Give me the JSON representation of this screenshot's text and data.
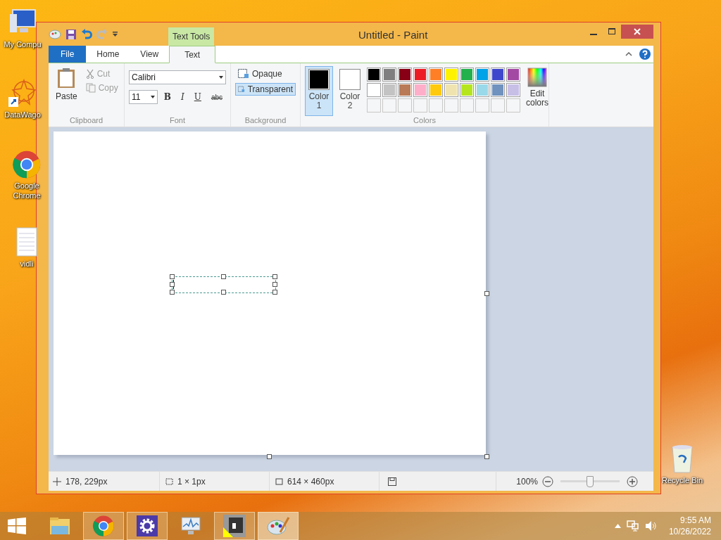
{
  "desktop_icons": [
    {
      "label": "My Compu",
      "kind": "computer"
    },
    {
      "label": "DataWago",
      "kind": "star"
    },
    {
      "label": "Google Chrome",
      "kind": "chrome"
    },
    {
      "label": "vidli",
      "kind": "document"
    }
  ],
  "recycle_bin": {
    "label": "Recycle Bin"
  },
  "window": {
    "title": "Untitled - Paint",
    "context_label": "Text Tools",
    "quick_access": [
      {
        "kind": "app"
      },
      {
        "kind": "save",
        "disabled": false
      },
      {
        "kind": "undo",
        "disabled": false
      },
      {
        "kind": "redo",
        "disabled": true
      },
      {
        "kind": "customize",
        "disabled": false
      }
    ],
    "tabs": [
      {
        "label": "File",
        "kind": "file",
        "selected": false
      },
      {
        "label": "Home",
        "kind": "tab",
        "selected": false
      },
      {
        "label": "View",
        "kind": "tab",
        "selected": false
      },
      {
        "label": "Text",
        "kind": "tab",
        "selected": true
      }
    ],
    "clipboard": {
      "label": "Clipboard",
      "paste": "Paste",
      "cut": {
        "label": "Cut",
        "disabled": true
      },
      "copy": {
        "label": "Copy",
        "disabled": true
      }
    },
    "font": {
      "label": "Font",
      "family": "Calibri",
      "size": "11",
      "styles": [
        {
          "label": "B",
          "kind": "bold"
        },
        {
          "label": "I",
          "kind": "italic"
        },
        {
          "label": "U",
          "kind": "underline"
        },
        {
          "label": "abc",
          "kind": "strike"
        }
      ]
    },
    "background": {
      "label": "Background",
      "options": [
        {
          "label": "Opaque",
          "selected": false
        },
        {
          "label": "Transparent",
          "selected": true
        }
      ]
    },
    "colors": {
      "label": "Colors",
      "slots": [
        {
          "label": "Color",
          "number": "1",
          "color": "#000000",
          "selected": true
        },
        {
          "label": "Color",
          "number": "2",
          "color": "#ffffff",
          "selected": false
        }
      ],
      "palette": [
        {
          "color": "#000000"
        },
        {
          "color": "#7f7f7f"
        },
        {
          "color": "#880015"
        },
        {
          "color": "#ed1c24"
        },
        {
          "color": "#ff7f27"
        },
        {
          "color": "#fff200"
        },
        {
          "color": "#22b14c"
        },
        {
          "color": "#00a2e8"
        },
        {
          "color": "#3f48cc"
        },
        {
          "color": "#a349a4"
        },
        {
          "color": "#ffffff"
        },
        {
          "color": "#c3c3c3"
        },
        {
          "color": "#b97a57"
        },
        {
          "color": "#ffaec9"
        },
        {
          "color": "#ffc90e"
        },
        {
          "color": "#efe4b0"
        },
        {
          "color": "#b5e61d"
        },
        {
          "color": "#99d9ea"
        },
        {
          "color": "#7092be"
        },
        {
          "color": "#c8bfe7"
        }
      ],
      "edit": "Edit colors"
    },
    "status": {
      "position": "178, 229px",
      "selection": "1 × 1px",
      "size": "614 × 460px",
      "zoom": "100%",
      "zoom_slider": {
        "level": 0.5
      }
    }
  },
  "taskbar": {
    "items": [
      {
        "kind": "explorer",
        "open": false,
        "selected": false
      },
      {
        "kind": "chrome",
        "open": true,
        "selected": false
      },
      {
        "kind": "settings",
        "open": true,
        "selected": false
      },
      {
        "kind": "monitor",
        "open": false,
        "selected": false
      },
      {
        "kind": "app",
        "open": true,
        "selected": false
      },
      {
        "kind": "paint",
        "open": true,
        "selected": true
      }
    ],
    "time": "9:55 AM",
    "date": "10/26/2022"
  }
}
